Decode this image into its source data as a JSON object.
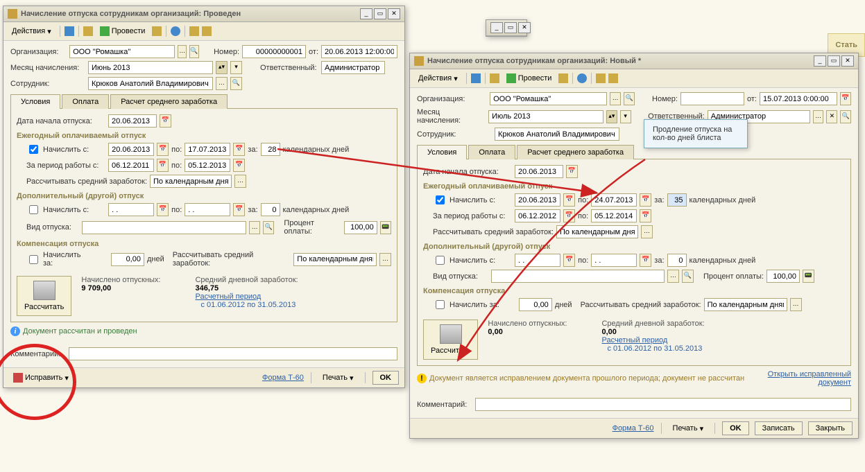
{
  "stat_btn": "Стать",
  "annotation_text": "Продление отпуска на кол-во дней блиста",
  "win1": {
    "title": "Начисление отпуска сотрудникам организаций: Проведен",
    "toolbar": {
      "actions": "Действия",
      "post": "Провести"
    },
    "org_lbl": "Организация:",
    "org_val": "ООО \"Ромашка\"",
    "num_lbl": "Номер:",
    "num_val": "00000000001",
    "from_lbl": "от:",
    "from_val": "20.06.2013 12:00:00",
    "month_lbl": "Месяц начисления:",
    "month_val": "Июнь 2013",
    "resp_lbl": "Ответственный:",
    "resp_val": "Администратор",
    "emp_lbl": "Сотрудник:",
    "emp_val": "Крюков Анатолий Владимирович",
    "tab1": "Условия",
    "tab2": "Оплата",
    "tab3": "Расчет среднего заработка",
    "start_lbl": "Дата начала отпуска:",
    "start_val": "20.06.2013",
    "grp1": "Ежегодный оплачиваемый отпуск",
    "accrue_lbl": "Начислить с:",
    "d1": "20.06.2013",
    "to_lbl": "по:",
    "d2": "17.07.2013",
    "for_lbl": "за:",
    "days": "28",
    "days_lbl": "календарных дней",
    "period_lbl": "За период работы с:",
    "pd1": "06.12.2011",
    "pd2": "05.12.2013",
    "avg_lbl": "Рассчитывать средний заработок:",
    "avg_val": "По календарным дня",
    "grp2": "Дополнительный (другой) отпуск",
    "accrue2_lbl": "Начислить с:",
    "empty_date": ". .",
    "days0": "0",
    "type_lbl": "Вид отпуска:",
    "pct_lbl": "Процент оплаты:",
    "pct_val": "100,00",
    "grp3": "Компенсация отпуска",
    "comp_lbl": "Начислить за:",
    "comp_val": "0,00",
    "comp_days": "дней",
    "comp_avg_lbl": "Рассчитывать средний заработок:",
    "comp_avg_val": "По календарным дням",
    "calc_btn": "Рассчитать",
    "sum1_lbl": "Начислено отпускных:",
    "sum1_val": "9 709,00",
    "sum2_lbl": "Средний дневной заработок:",
    "sum2_val": "346,75",
    "period_calc_lbl": "Расчетный период",
    "period_calc_val": "с 01.06.2012 по 31.05.2013",
    "status": "Документ рассчитан и проведен",
    "comment_lbl": "Комментарий:",
    "fix_btn": "Исправить",
    "form_btn": "Форма Т-60",
    "print_btn": "Печать",
    "ok_btn": "OK"
  },
  "win2": {
    "title": "Начисление отпуска сотрудникам организаций: Новый *",
    "toolbar": {
      "actions": "Действия",
      "post": "Провести"
    },
    "org_lbl": "Организация:",
    "org_val": "ООО \"Ромашка\"",
    "num_lbl": "Номер:",
    "num_val": "",
    "from_lbl": "от:",
    "from_val": "15.07.2013 0:00:00",
    "month_lbl": "Месяц начисления:",
    "month_val": "Июль 2013",
    "resp_lbl": "Ответственный:",
    "resp_val": "Администратор",
    "emp_lbl": "Сотрудник:",
    "emp_val": "Крюков Анатолий Владимирович",
    "tab1": "Условия",
    "tab2": "Оплата",
    "tab3": "Расчет среднего заработка",
    "start_lbl": "Дата начала отпуска:",
    "start_val": "20.06.2013",
    "grp1": "Ежегодный оплачиваемый отпуск",
    "accrue_lbl": "Начислить с:",
    "d1": "20.06.2013",
    "to_lbl": "по:",
    "d2": "24.07.2013",
    "for_lbl": "за:",
    "days": "35",
    "days_lbl": "календарных дней",
    "period_lbl": "За период работы с:",
    "pd1": "06.12.2012",
    "pd2": "05.12.2014",
    "avg_lbl": "Рассчитывать средний заработок:",
    "avg_val": "По календарным дня",
    "grp2": "Дополнительный (другой) отпуск",
    "accrue2_lbl": "Начислить с:",
    "empty_date": ". .",
    "days0": "0",
    "type_lbl": "Вид отпуска:",
    "pct_lbl": "Процент оплаты:",
    "pct_val": "100,00",
    "grp3": "Компенсация отпуска",
    "comp_lbl": "Начислить за:",
    "comp_val": "0,00",
    "comp_days": "дней",
    "comp_avg_lbl": "Рассчитывать средний заработок:",
    "comp_avg_val": "По календарным дням",
    "calc_btn": "Рассчитать",
    "sum1_lbl": "Начислено отпускных:",
    "sum1_val": "0,00",
    "sum2_lbl": "Средний дневной заработок:",
    "sum2_val": "0,00",
    "period_calc_lbl": "Расчетный период",
    "period_calc_val": "с 01.06.2012 по 31.05.2013",
    "status": "Документ является исправлением документа прошлого периода; документ не рассчитан",
    "open_link": "Открыть исправленный документ",
    "comment_lbl": "Комментарий:",
    "form_btn": "Форма Т-60",
    "print_btn": "Печать",
    "ok_btn": "OK",
    "save_btn": "Записать",
    "close_btn": "Закрыть"
  }
}
